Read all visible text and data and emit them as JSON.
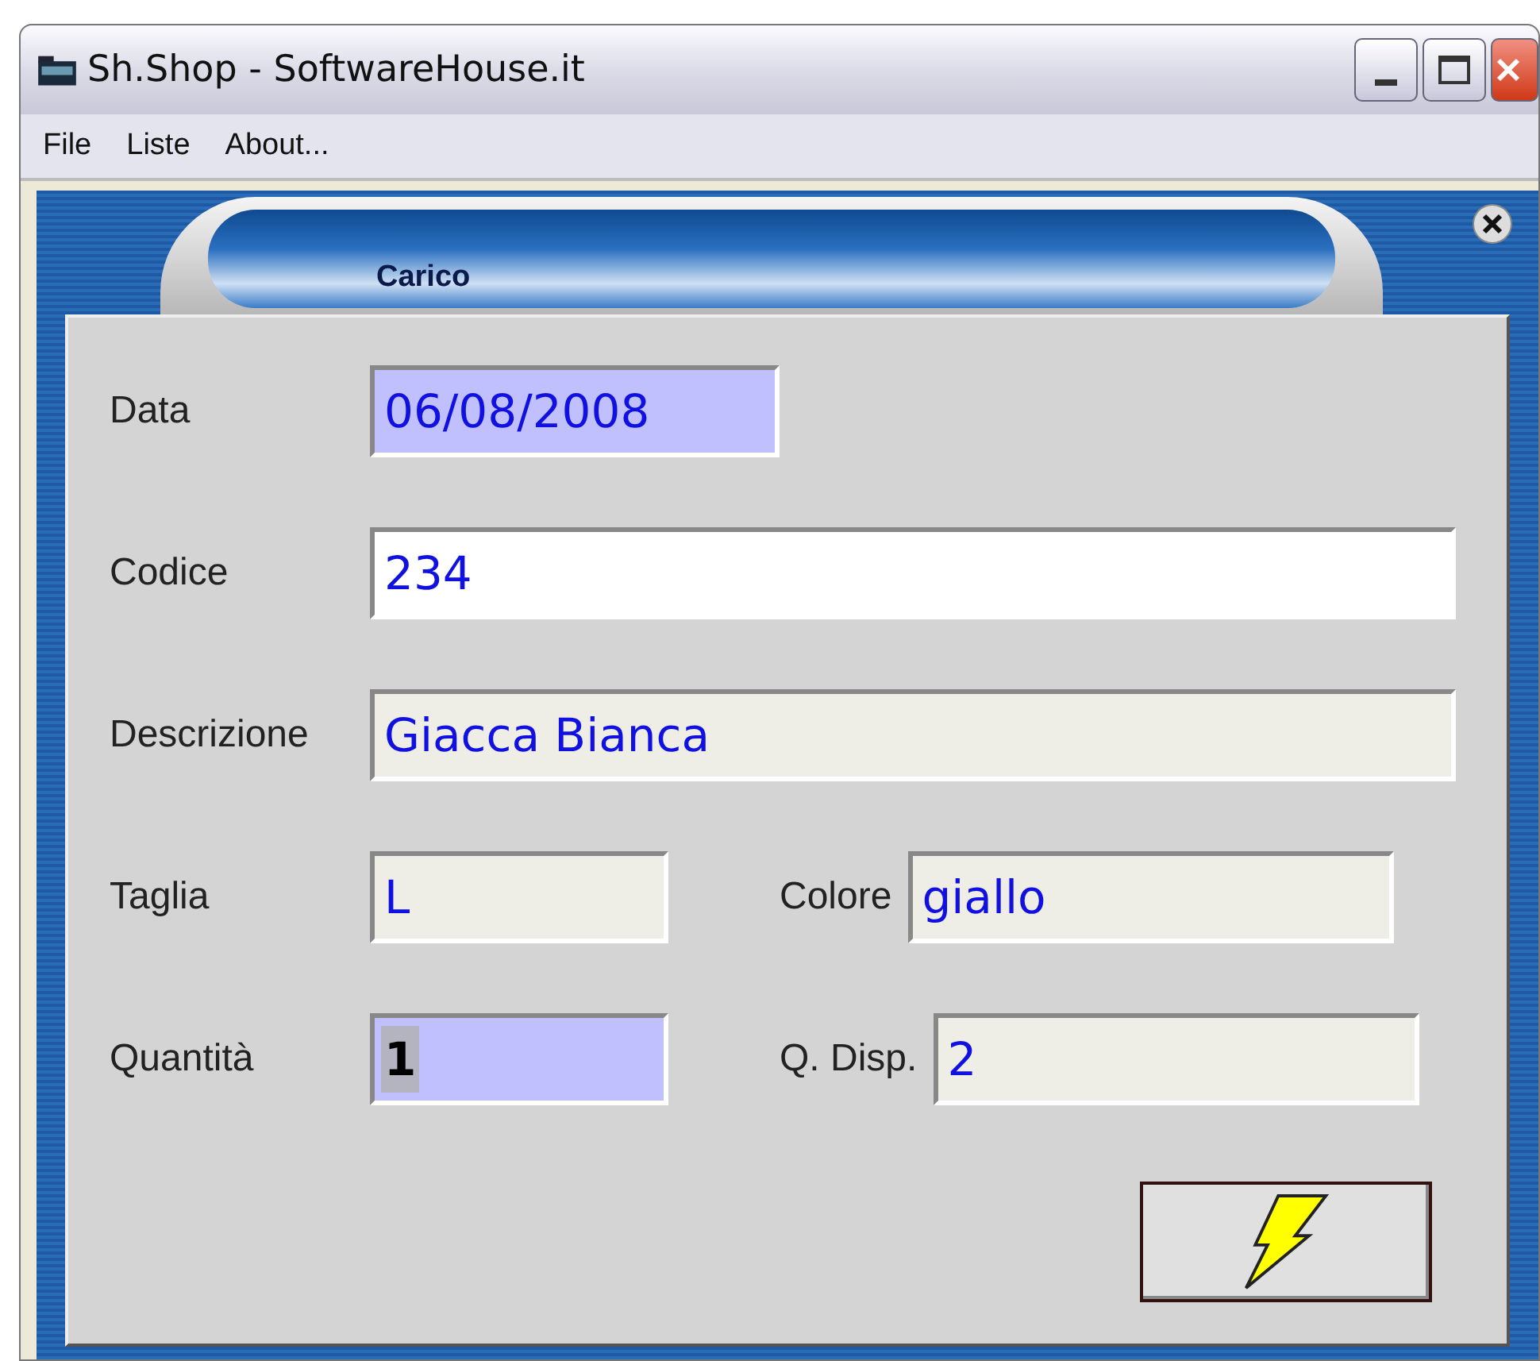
{
  "window": {
    "title": "Sh.Shop - SoftwareHouse.it"
  },
  "menu": [
    {
      "label": "File"
    },
    {
      "label": "Liste"
    },
    {
      "label": "About..."
    }
  ],
  "form": {
    "title": "Carico",
    "rows": [
      [
        {
          "label": "Data",
          "value": "06/08/2008",
          "kind": "accent",
          "selected": false
        }
      ],
      [
        {
          "label": "Codice",
          "value": "234",
          "kind": "plain",
          "selected": false
        }
      ],
      [
        {
          "label": "Descrizione",
          "value": "Giacca Bianca",
          "kind": "readonly",
          "selected": false
        }
      ],
      [
        {
          "label": "Taglia",
          "value": "L",
          "kind": "readonly",
          "selected": false
        },
        {
          "label": "Colore",
          "value": "giallo",
          "kind": "readonly",
          "selected": false
        }
      ],
      [
        {
          "label": "Quantità",
          "value": "1",
          "kind": "accent",
          "selected": true
        },
        {
          "label": "Q. Disp.",
          "value": "2",
          "kind": "readonly",
          "selected": false
        }
      ]
    ]
  }
}
